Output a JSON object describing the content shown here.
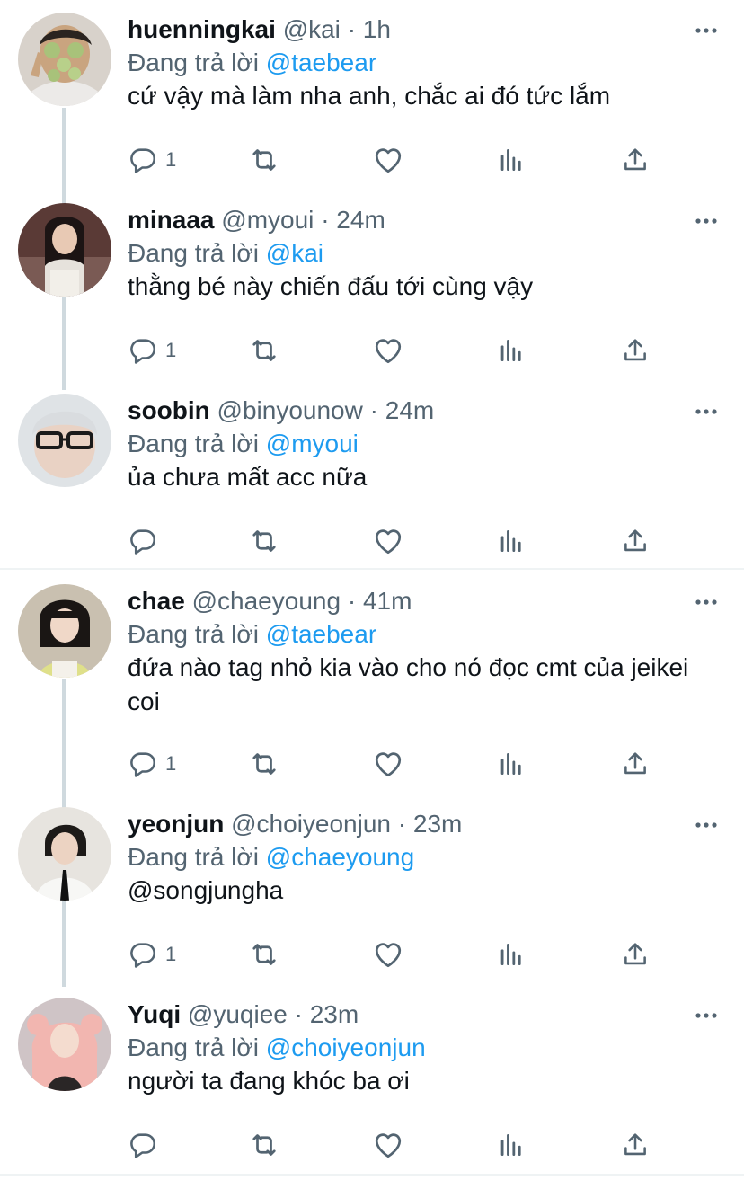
{
  "replying_label": "Đang trả lời",
  "colors": {
    "text": "#0f1419",
    "secondary": "#536471",
    "accent": "#1d9bf0",
    "thread_line": "#cfd9de"
  },
  "icons": [
    "reply-icon",
    "retweet-icon",
    "like-icon",
    "views-icon",
    "share-icon",
    "more-icon"
  ],
  "tweets": [
    {
      "name": "huenningkai",
      "handle": "@kai",
      "dot": "·",
      "time": "1h",
      "replying_to": "@taebear",
      "text": "cứ vậy mà làm nha anh, chắc ai đó tức lắm",
      "reply_count": "1"
    },
    {
      "name": "minaaa",
      "handle": "@myoui",
      "dot": "·",
      "time": "24m",
      "replying_to": "@kai",
      "text": "thằng bé này chiến đấu tới cùng vậy",
      "reply_count": "1"
    },
    {
      "name": "soobin",
      "handle": "@binyounow",
      "dot": "·",
      "time": "24m",
      "replying_to": "@myoui",
      "text": "ủa chưa mất acc nữa",
      "reply_count": ""
    },
    {
      "name": "chae",
      "handle": "@chaeyoung",
      "dot": "·",
      "time": "41m",
      "replying_to": "@taebear",
      "text": "đứa nào tag nhỏ kia vào cho nó đọc cmt của jeikei coi",
      "reply_count": "1"
    },
    {
      "name": "yeonjun",
      "handle": "@choiyeonjun",
      "dot": "·",
      "time": "23m",
      "replying_to": "@chaeyoung",
      "text": "@songjungha",
      "reply_count": "1"
    },
    {
      "name": "Yuqi",
      "handle": "@yuqiee",
      "dot": "·",
      "time": "23m",
      "replying_to": "@choiyeonjun",
      "text": "người ta đang khóc ba ơi",
      "reply_count": ""
    }
  ]
}
